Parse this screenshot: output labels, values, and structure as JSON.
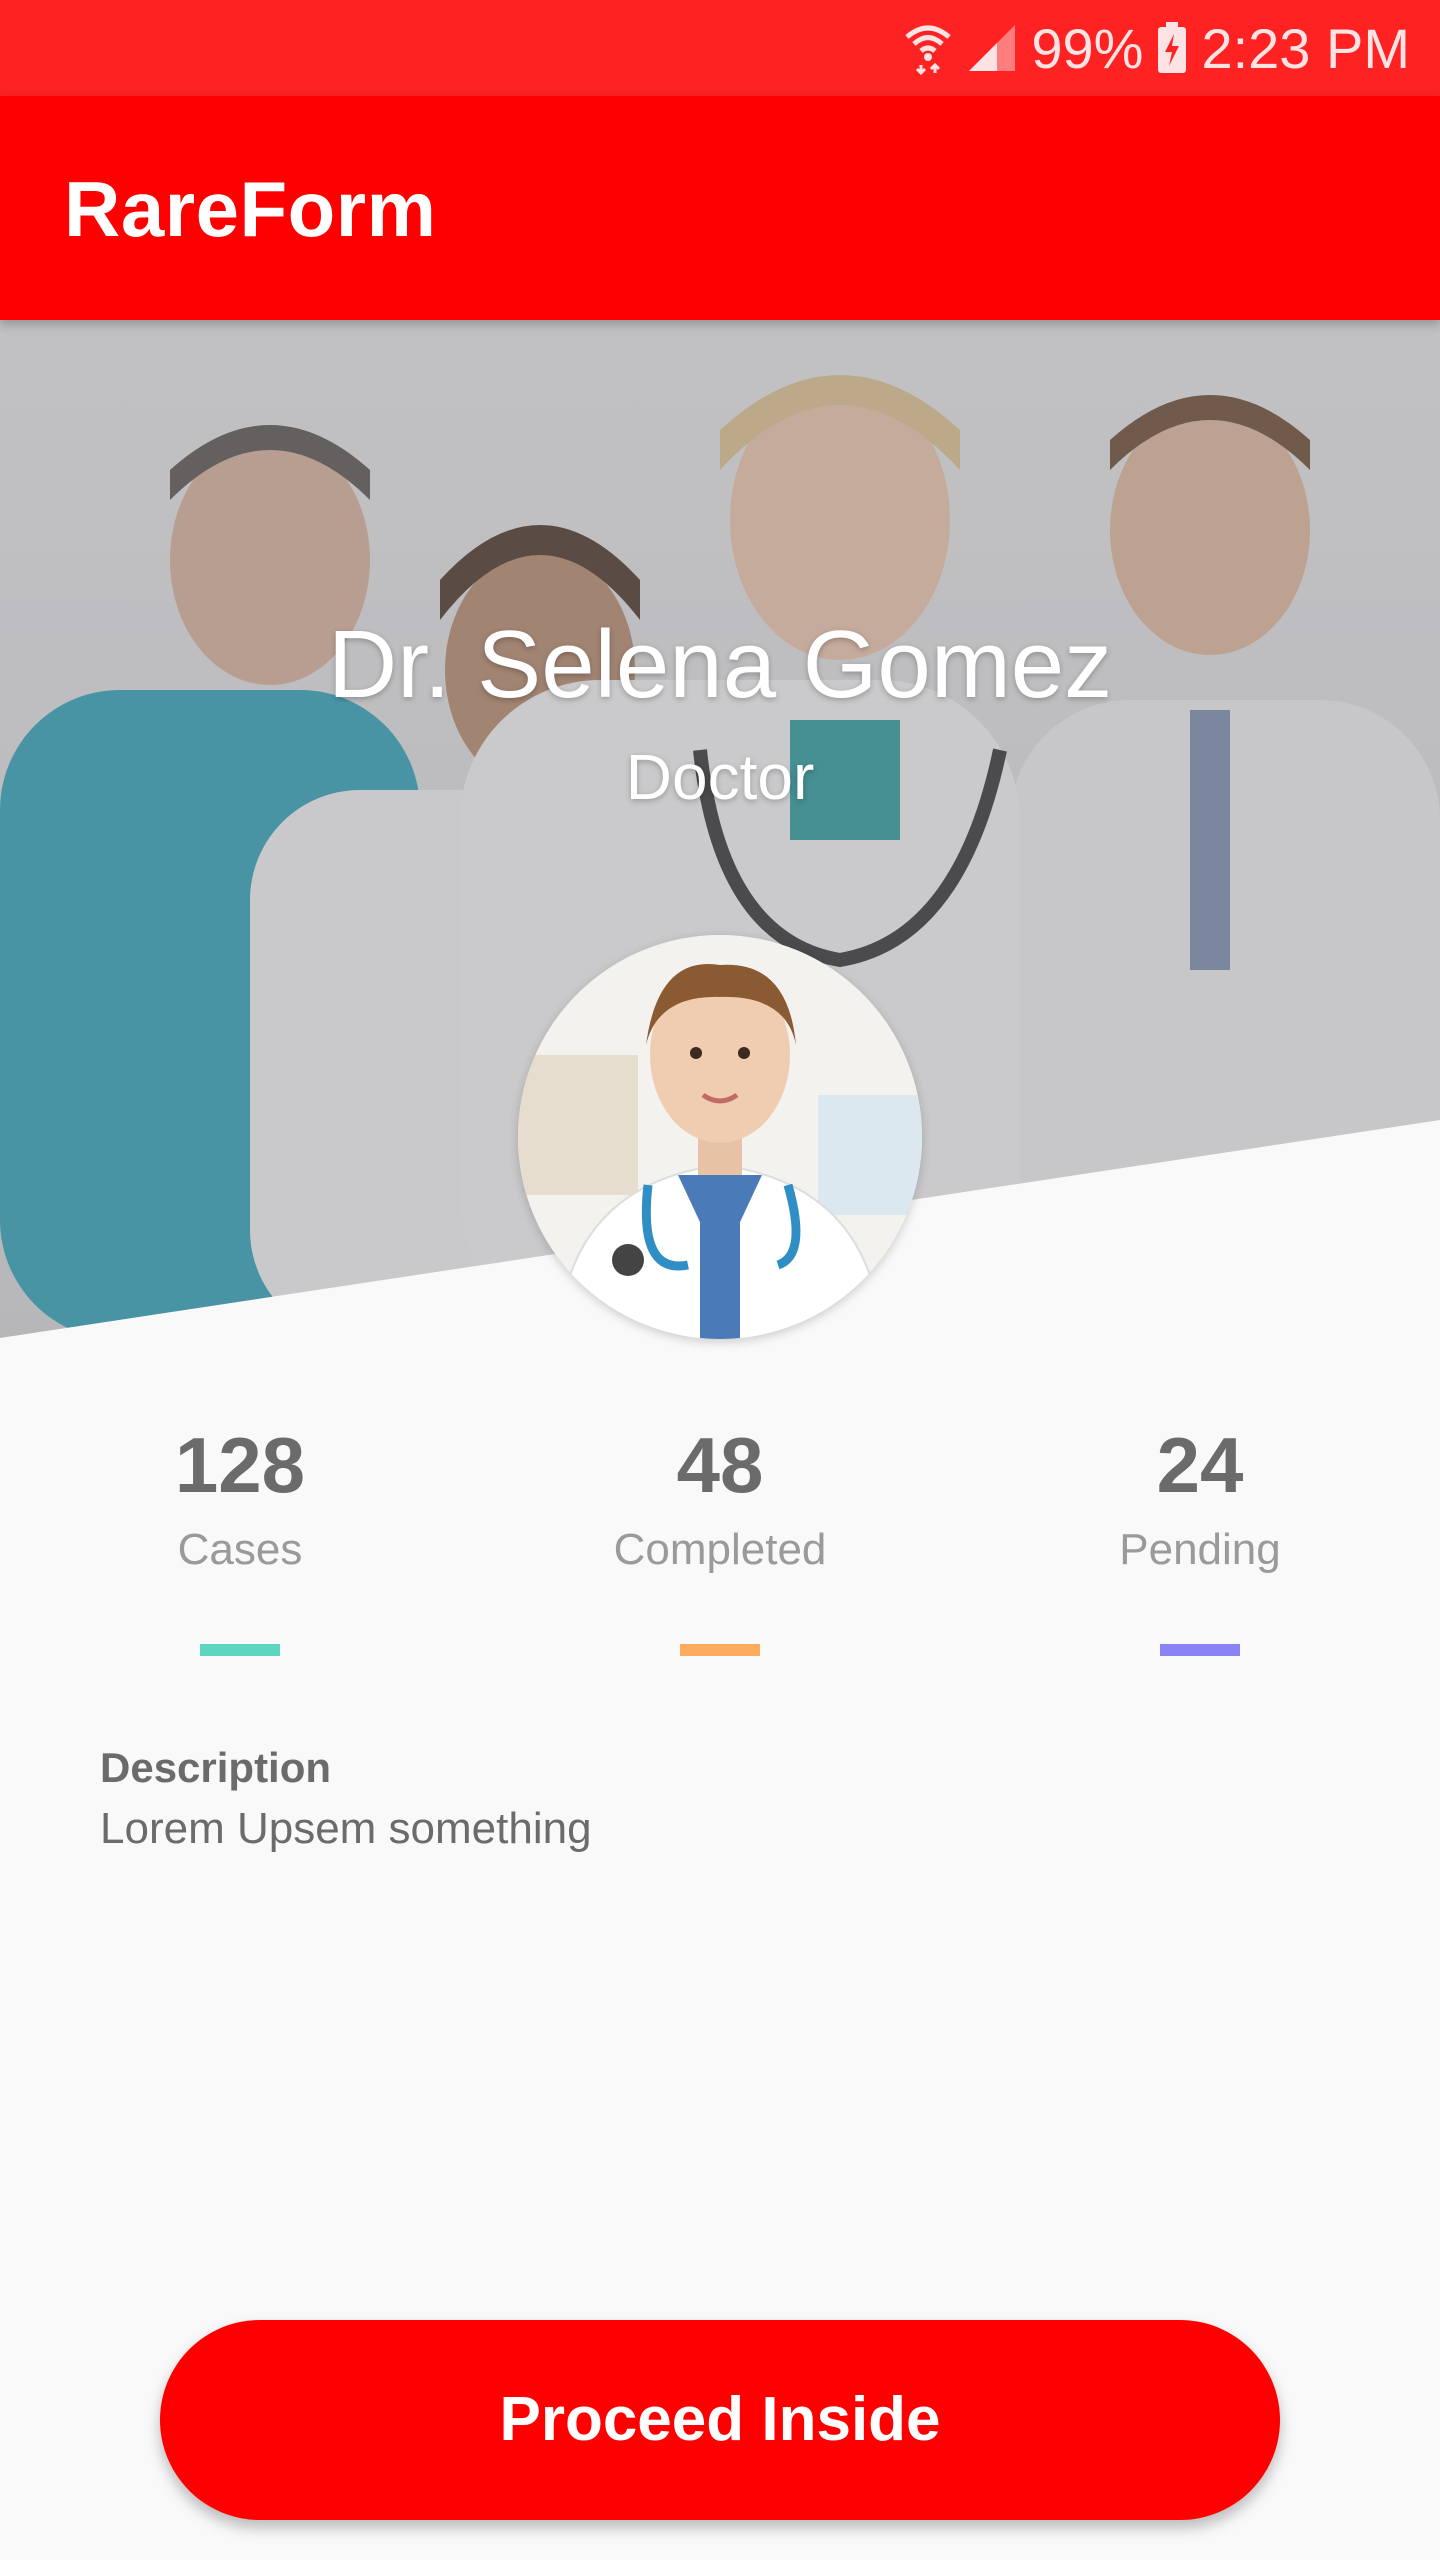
{
  "status_bar": {
    "battery": "99%",
    "time": "2:23 PM",
    "icons": [
      "wifi-icon",
      "signal-icon",
      "battery-charging-icon"
    ]
  },
  "app_bar": {
    "title": "RareForm",
    "color": "#ff0000"
  },
  "profile": {
    "name": "Dr. Selena Gomez",
    "role": "Doctor"
  },
  "stats": [
    {
      "value": "128",
      "label": "Cases",
      "accent": "#5dd6c0"
    },
    {
      "value": "48",
      "label": "Completed",
      "accent": "#ffab5e"
    },
    {
      "value": "24",
      "label": "Pending",
      "accent": "#8a83f5"
    }
  ],
  "description": {
    "title": "Description",
    "text": "Lorem Upsem something"
  },
  "actions": {
    "proceed_label": "Proceed Inside"
  }
}
